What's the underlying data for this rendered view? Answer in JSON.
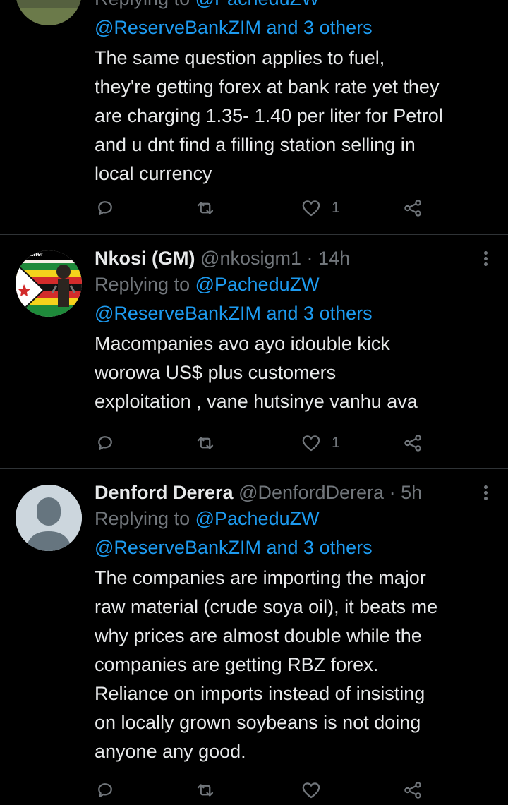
{
  "tweets": [
    {
      "replying_prefix": "Replying to",
      "replying_to": "@PacheduZW",
      "mention2": "@ReserveBankZIM",
      "and_others": "and 3 others",
      "lines": [
        "The same question applies to fuel,",
        "they're getting forex at bank rate yet they",
        "are charging 1.35- 1.40 per liter for Petrol",
        "and u dnt find a filling station selling in",
        "local currency"
      ],
      "likes": "1"
    },
    {
      "name": "Nkosi (GM)",
      "handle": "@nkosigm1",
      "separator": "·",
      "time": "14h",
      "replying_prefix": "Replying to",
      "replying_to": "@PacheduZW",
      "mention2": "@ReserveBankZIM",
      "and_others": "and 3 others",
      "lines": [
        "Macompanies avo ayo idouble kick",
        "worowa US$ plus customers",
        "exploitation , vane hutsinye vanhu ava"
      ],
      "likes": "1",
      "avatar_badge": "esmatter"
    },
    {
      "name": "Denford Derera",
      "handle": "@DenfordDerera",
      "separator": "·",
      "time": "5h",
      "replying_prefix": "Replying to",
      "replying_to": "@PacheduZW",
      "mention2": "@ReserveBankZIM",
      "and_others": "and 3 others",
      "lines": [
        "The companies are importing the major",
        "raw material (crude soya oil), it beats me",
        "why prices are almost double while the",
        "companies are getting RBZ forex.",
        "Reliance on imports instead of insisting",
        "on locally grown soybeans is not doing",
        "anyone any good."
      ]
    }
  ],
  "colors": {
    "background": "#000000",
    "text": "#e7e9ea",
    "muted": "#71767b",
    "link": "#1d9bf0",
    "divider": "#2f3336"
  },
  "icons": [
    "reply-icon",
    "retweet-icon",
    "like-icon",
    "share-icon",
    "more-icon"
  ]
}
